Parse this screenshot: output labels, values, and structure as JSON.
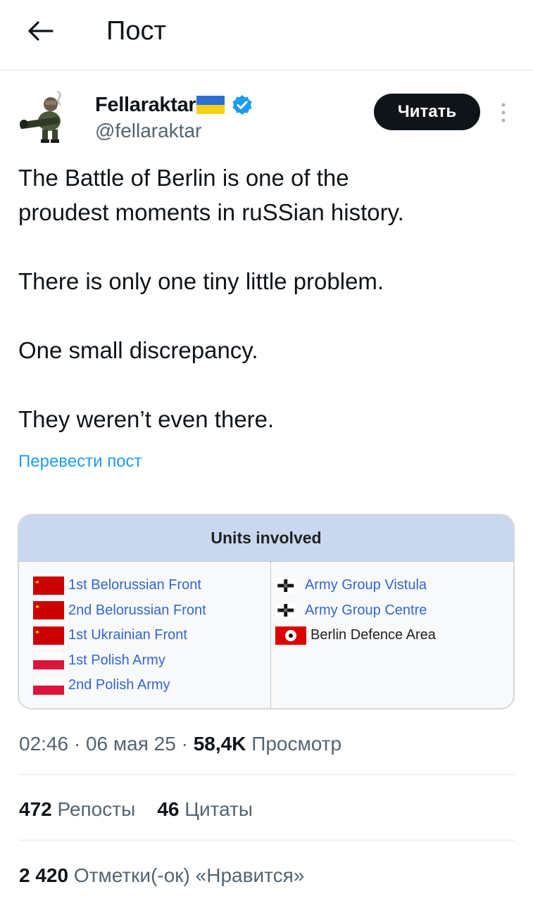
{
  "header": {
    "title": "Пост"
  },
  "author": {
    "name": "Fellaraktar",
    "handle": "@fellaraktar",
    "follow_label": "Читать"
  },
  "post": {
    "paragraphs": [
      [
        "The Battle of Berlin is one of the",
        "proudest moments in ruSSian history."
      ],
      [
        "There is only one tiny little problem."
      ],
      [
        "One small discrepancy."
      ],
      [
        "They weren’t even there."
      ]
    ],
    "translate_label": "Перевести пост"
  },
  "media": {
    "title": "Units involved",
    "left_units": [
      {
        "label": "1st Belorussian Front",
        "flag": "soviet-flag"
      },
      {
        "label": "2nd Belorussian Front",
        "flag": "soviet-flag"
      },
      {
        "label": "1st Ukrainian Front",
        "flag": "soviet-flag"
      },
      {
        "label": "1st Polish Army",
        "flag": "polish-flag"
      },
      {
        "label": "2nd Polish Army",
        "flag": "polish-flag"
      }
    ],
    "right_units": [
      {
        "label": "Army Group Vistula",
        "flag": "war-ensign-flag"
      },
      {
        "label": "Army Group Centre",
        "flag": "war-ensign-flag"
      },
      {
        "label": "Berlin Defence Area",
        "flag": "nazi-flag"
      }
    ]
  },
  "meta": {
    "time": "02:46",
    "date": "06 мая 25",
    "views_count": "58,4K",
    "views_label": "Просмотр",
    "separator": " · "
  },
  "stats": {
    "reposts_count": "472",
    "reposts_label": "Репосты",
    "quotes_count": "46",
    "quotes_label": "Цитаты",
    "likes_count": "2 420",
    "likes_label": "Отметки(-ок) «Нравится»"
  },
  "colors": {
    "link": "#1d9bf0",
    "secondary_text": "#536471",
    "button_bg": "#0f1419",
    "verified": "#1d9bf0",
    "soviet_red": "#cc0000",
    "polish_red": "#dc143c",
    "units_header_bg": "#c9d8ef"
  }
}
